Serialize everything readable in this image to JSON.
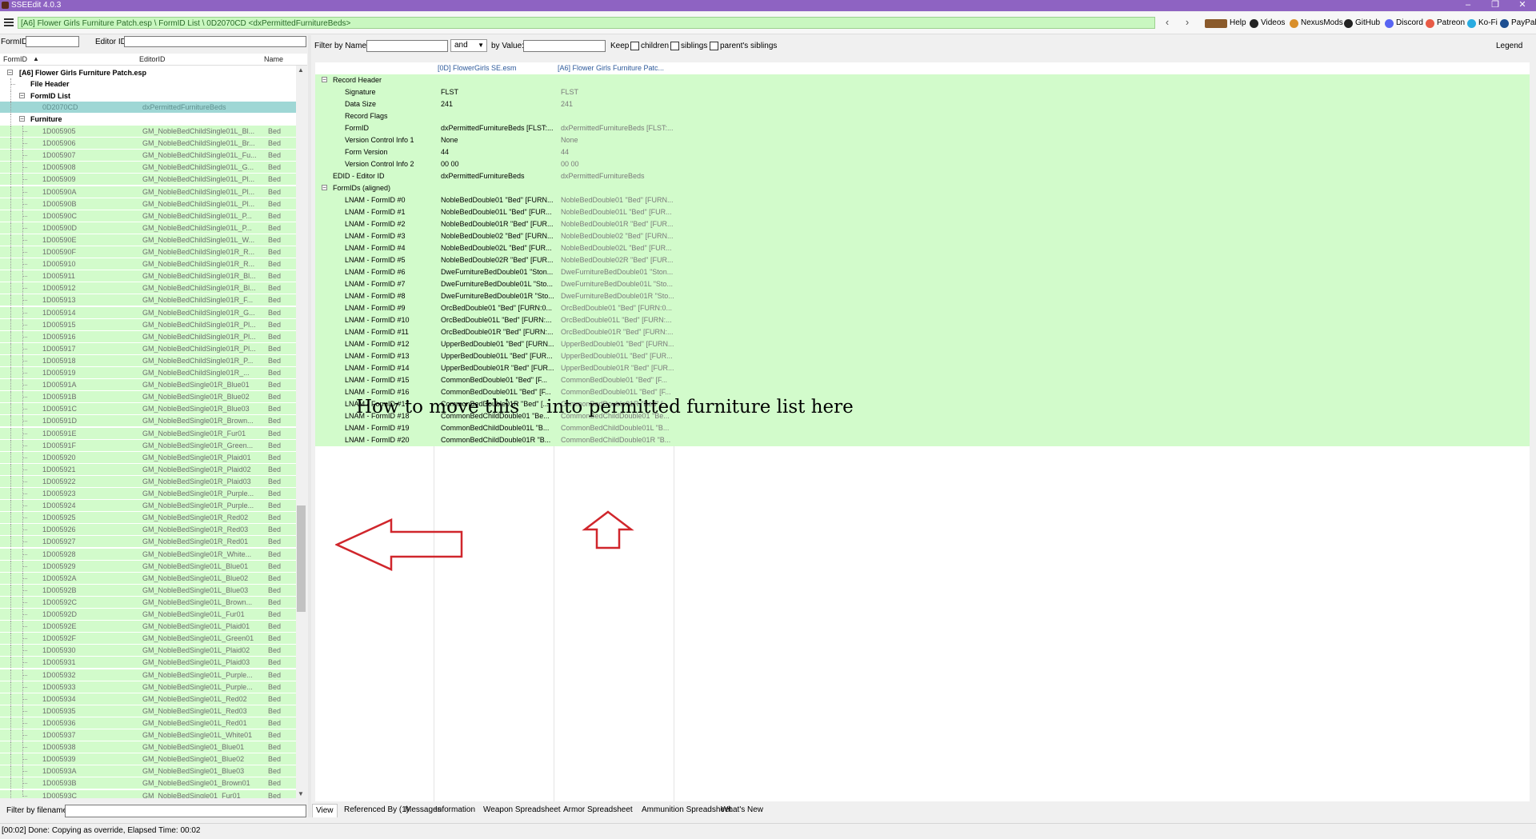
{
  "window": {
    "title": "SSEEdit 4.0.3",
    "controls": [
      "–",
      "❐",
      "✕"
    ]
  },
  "nav": {
    "path": "[A6] Flower Girls Furniture Patch.esp \\ FormID List \\ 0D2070CD <dxPermittedFurnitureBeds>",
    "links": [
      {
        "label": "Help",
        "icon": "book-icon",
        "color": "#8a5a2b"
      },
      {
        "label": "Videos",
        "icon": "videos-icon",
        "color": "#222222"
      },
      {
        "label": "NexusMods",
        "icon": "nexusmods-icon",
        "color": "#d98f2b"
      },
      {
        "label": "GitHub",
        "icon": "github-icon",
        "color": "#222222"
      },
      {
        "label": "Discord",
        "icon": "discord-icon",
        "color": "#5865f2"
      },
      {
        "label": "Patreon",
        "icon": "patreon-icon",
        "color": "#e85b46"
      },
      {
        "label": "Ko-Fi",
        "icon": "kofi-icon",
        "color": "#29abe0"
      },
      {
        "label": "PayPal",
        "icon": "paypal-icon",
        "color": "#1d4f91"
      }
    ]
  },
  "left": {
    "formid_label": "FormID",
    "editorid_label": "Editor ID",
    "columns": [
      "FormID",
      "EditorID",
      "Name"
    ],
    "plugin": "[A6] Flower Girls Furniture Patch.esp",
    "file_header": "File Header",
    "formid_list_group": "FormID List",
    "selected_record": {
      "formid": "0D2070CD",
      "editorid": "dxPermittedFurnitureBeds"
    },
    "furniture_group": "Furniture",
    "furniture_rows": [
      [
        "1D005905",
        "GM_NobleBedChildSingle01L_Bl...",
        "Bed"
      ],
      [
        "1D005906",
        "GM_NobleBedChildSingle01L_Br...",
        "Bed"
      ],
      [
        "1D005907",
        "GM_NobleBedChildSingle01L_Fu...",
        "Bed"
      ],
      [
        "1D005908",
        "GM_NobleBedChildSingle01L_G...",
        "Bed"
      ],
      [
        "1D005909",
        "GM_NobleBedChildSingle01L_Pl...",
        "Bed"
      ],
      [
        "1D00590A",
        "GM_NobleBedChildSingle01L_Pl...",
        "Bed"
      ],
      [
        "1D00590B",
        "GM_NobleBedChildSingle01L_Pl...",
        "Bed"
      ],
      [
        "1D00590C",
        "GM_NobleBedChildSingle01L_P...",
        "Bed"
      ],
      [
        "1D00590D",
        "GM_NobleBedChildSingle01L_P...",
        "Bed"
      ],
      [
        "1D00590E",
        "GM_NobleBedChildSingle01L_W...",
        "Bed"
      ],
      [
        "1D00590F",
        "GM_NobleBedChildSingle01R_R...",
        "Bed"
      ],
      [
        "1D005910",
        "GM_NobleBedChildSingle01R_R...",
        "Bed"
      ],
      [
        "1D005911",
        "GM_NobleBedChildSingle01R_Bl...",
        "Bed"
      ],
      [
        "1D005912",
        "GM_NobleBedChildSingle01R_Bl...",
        "Bed"
      ],
      [
        "1D005913",
        "GM_NobleBedChildSingle01R_F...",
        "Bed"
      ],
      [
        "1D005914",
        "GM_NobleBedChildSingle01R_G...",
        "Bed"
      ],
      [
        "1D005915",
        "GM_NobleBedChildSingle01R_Pl...",
        "Bed"
      ],
      [
        "1D005916",
        "GM_NobleBedChildSingle01R_Pl...",
        "Bed"
      ],
      [
        "1D005917",
        "GM_NobleBedChildSingle01R_Pl...",
        "Bed"
      ],
      [
        "1D005918",
        "GM_NobleBedChildSingle01R_P...",
        "Bed"
      ],
      [
        "1D005919",
        "GM_NobleBedChildSingle01R_...",
        "Bed"
      ],
      [
        "1D00591A",
        "GM_NobleBedSingle01R_Blue01",
        "Bed"
      ],
      [
        "1D00591B",
        "GM_NobleBedSingle01R_Blue02",
        "Bed"
      ],
      [
        "1D00591C",
        "GM_NobleBedSingle01R_Blue03",
        "Bed"
      ],
      [
        "1D00591D",
        "GM_NobleBedSingle01R_Brown...",
        "Bed"
      ],
      [
        "1D00591E",
        "GM_NobleBedSingle01R_Fur01",
        "Bed"
      ],
      [
        "1D00591F",
        "GM_NobleBedSingle01R_Green...",
        "Bed"
      ],
      [
        "1D005920",
        "GM_NobleBedSingle01R_Plaid01",
        "Bed"
      ],
      [
        "1D005921",
        "GM_NobleBedSingle01R_Plaid02",
        "Bed"
      ],
      [
        "1D005922",
        "GM_NobleBedSingle01R_Plaid03",
        "Bed"
      ],
      [
        "1D005923",
        "GM_NobleBedSingle01R_Purple...",
        "Bed"
      ],
      [
        "1D005924",
        "GM_NobleBedSingle01R_Purple...",
        "Bed"
      ],
      [
        "1D005925",
        "GM_NobleBedSingle01R_Red02",
        "Bed"
      ],
      [
        "1D005926",
        "GM_NobleBedSingle01R_Red03",
        "Bed"
      ],
      [
        "1D005927",
        "GM_NobleBedSingle01R_Red01",
        "Bed"
      ],
      [
        "1D005928",
        "GM_NobleBedSingle01R_White...",
        "Bed"
      ],
      [
        "1D005929",
        "GM_NobleBedSingle01L_Blue01",
        "Bed"
      ],
      [
        "1D00592A",
        "GM_NobleBedSingle01L_Blue02",
        "Bed"
      ],
      [
        "1D00592B",
        "GM_NobleBedSingle01L_Blue03",
        "Bed"
      ],
      [
        "1D00592C",
        "GM_NobleBedSingle01L_Brown...",
        "Bed"
      ],
      [
        "1D00592D",
        "GM_NobleBedSingle01L_Fur01",
        "Bed"
      ],
      [
        "1D00592E",
        "GM_NobleBedSingle01L_Plaid01",
        "Bed"
      ],
      [
        "1D00592F",
        "GM_NobleBedSingle01L_Green01",
        "Bed"
      ],
      [
        "1D005930",
        "GM_NobleBedSingle01L_Plaid02",
        "Bed"
      ],
      [
        "1D005931",
        "GM_NobleBedSingle01L_Plaid03",
        "Bed"
      ],
      [
        "1D005932",
        "GM_NobleBedSingle01L_Purple...",
        "Bed"
      ],
      [
        "1D005933",
        "GM_NobleBedSingle01L_Purple...",
        "Bed"
      ],
      [
        "1D005934",
        "GM_NobleBedSingle01L_Red02",
        "Bed"
      ],
      [
        "1D005935",
        "GM_NobleBedSingle01L_Red03",
        "Bed"
      ],
      [
        "1D005936",
        "GM_NobleBedSingle01L_Red01",
        "Bed"
      ],
      [
        "1D005937",
        "GM_NobleBedSingle01L_White01",
        "Bed"
      ],
      [
        "1D005938",
        "GM_NobleBedSingle01_Blue01",
        "Bed"
      ],
      [
        "1D005939",
        "GM_NobleBedSingle01_Blue02",
        "Bed"
      ],
      [
        "1D00593A",
        "GM_NobleBedSingle01_Blue03",
        "Bed"
      ],
      [
        "1D00593B",
        "GM_NobleBedSingle01_Brown01",
        "Bed"
      ],
      [
        "1D00593C",
        "GM_NobleBedSingle01_Fur01",
        "Bed"
      ]
    ],
    "filter_filename_label": "Filter by filename:"
  },
  "right": {
    "filter_name_label": "Filter by Name:",
    "and_option": "and",
    "by_value_label": "by Value:",
    "keep_label": "Keep",
    "keep_options": [
      "children",
      "siblings",
      "parent's siblings"
    ],
    "legend": "Legend",
    "col_headers": [
      "[0D] FlowerGirls SE.esm",
      "[A6] Flower Girls Furniture Patc..."
    ],
    "record_header": "Record Header",
    "header_fields": [
      [
        "Signature",
        "FLST",
        "FLST"
      ],
      [
        "Data Size",
        "241",
        "241"
      ],
      [
        "Record Flags",
        "",
        ""
      ],
      [
        "FormID",
        "dxPermittedFurnitureBeds [FLST:...",
        "dxPermittedFurnitureBeds [FLST:..."
      ],
      [
        "Version Control Info 1",
        "None",
        "None"
      ],
      [
        "Form Version",
        "44",
        "44"
      ],
      [
        "Version Control Info 2",
        "00 00",
        "00 00"
      ]
    ],
    "edid": [
      "EDID - Editor ID",
      "dxPermittedFurnitureBeds",
      "dxPermittedFurnitureBeds"
    ],
    "formids_section": "FormIDs (aligned)",
    "lnam_rows": [
      [
        "LNAM - FormID #0",
        "NobleBedDouble01 \"Bed\" [FURN...",
        "NobleBedDouble01 \"Bed\" [FURN..."
      ],
      [
        "LNAM - FormID #1",
        "NobleBedDouble01L \"Bed\" [FUR...",
        "NobleBedDouble01L \"Bed\" [FUR..."
      ],
      [
        "LNAM - FormID #2",
        "NobleBedDouble01R \"Bed\" [FUR...",
        "NobleBedDouble01R \"Bed\" [FUR..."
      ],
      [
        "LNAM - FormID #3",
        "NobleBedDouble02 \"Bed\" [FURN...",
        "NobleBedDouble02 \"Bed\" [FURN..."
      ],
      [
        "LNAM - FormID #4",
        "NobleBedDouble02L \"Bed\" [FUR...",
        "NobleBedDouble02L \"Bed\" [FUR..."
      ],
      [
        "LNAM - FormID #5",
        "NobleBedDouble02R \"Bed\" [FUR...",
        "NobleBedDouble02R \"Bed\" [FUR..."
      ],
      [
        "LNAM - FormID #6",
        "DweFurnitureBedDouble01 \"Ston...",
        "DweFurnitureBedDouble01 \"Ston..."
      ],
      [
        "LNAM - FormID #7",
        "DweFurnitureBedDouble01L \"Sto...",
        "DweFurnitureBedDouble01L \"Sto..."
      ],
      [
        "LNAM - FormID #8",
        "DweFurnitureBedDouble01R \"Sto...",
        "DweFurnitureBedDouble01R \"Sto..."
      ],
      [
        "LNAM - FormID #9",
        "OrcBedDouble01 \"Bed\" [FURN:0...",
        "OrcBedDouble01 \"Bed\" [FURN:0..."
      ],
      [
        "LNAM - FormID #10",
        "OrcBedDouble01L \"Bed\" [FURN:...",
        "OrcBedDouble01L \"Bed\" [FURN:..."
      ],
      [
        "LNAM - FormID #11",
        "OrcBedDouble01R \"Bed\" [FURN:...",
        "OrcBedDouble01R \"Bed\" [FURN:..."
      ],
      [
        "LNAM - FormID #12",
        "UpperBedDouble01 \"Bed\" [FURN...",
        "UpperBedDouble01 \"Bed\" [FURN..."
      ],
      [
        "LNAM - FormID #13",
        "UpperBedDouble01L \"Bed\" [FUR...",
        "UpperBedDouble01L \"Bed\" [FUR..."
      ],
      [
        "LNAM - FormID #14",
        "UpperBedDouble01R \"Bed\" [FUR...",
        "UpperBedDouble01R \"Bed\" [FUR..."
      ],
      [
        "LNAM - FormID #15",
        "CommonBedDouble01 \"Bed\" [F...",
        "CommonBedDouble01 \"Bed\" [F..."
      ],
      [
        "LNAM - FormID #16",
        "CommonBedDouble01L \"Bed\" [F...",
        "CommonBedDouble01L \"Bed\" [F..."
      ],
      [
        "LNAM - FormID #17",
        "CommonBedDouble01R \"Bed\" [...",
        "CommonBedDouble01R \"Bed\" [..."
      ],
      [
        "LNAM - FormID #18",
        "CommonBedChildDouble01 \"Be...",
        "CommonBedChildDouble01 \"Be..."
      ],
      [
        "LNAM - FormID #19",
        "CommonBedChildDouble01L \"B...",
        "CommonBedChildDouble01L \"B..."
      ],
      [
        "LNAM - FormID #20",
        "CommonBedChildDouble01R \"B...",
        "CommonBedChildDouble01R \"B..."
      ]
    ],
    "annotation_left": "How to move this",
    "annotation_right": "into permitted furniture list here",
    "arrow_color": "#d0262c",
    "tabs": [
      "View",
      "Referenced By (1)",
      "Messages",
      "Information",
      "Weapon Spreadsheet",
      "Armor Spreadsheet",
      "Ammunition Spreadsheet",
      "What's New"
    ]
  },
  "status": "[00:02] Done: Copying as override, Elapsed Time: 00:02",
  "colors": {
    "title_bar": "#8e63c2",
    "override_green": "#d2fbcb",
    "selection": "#9fd7d5"
  }
}
